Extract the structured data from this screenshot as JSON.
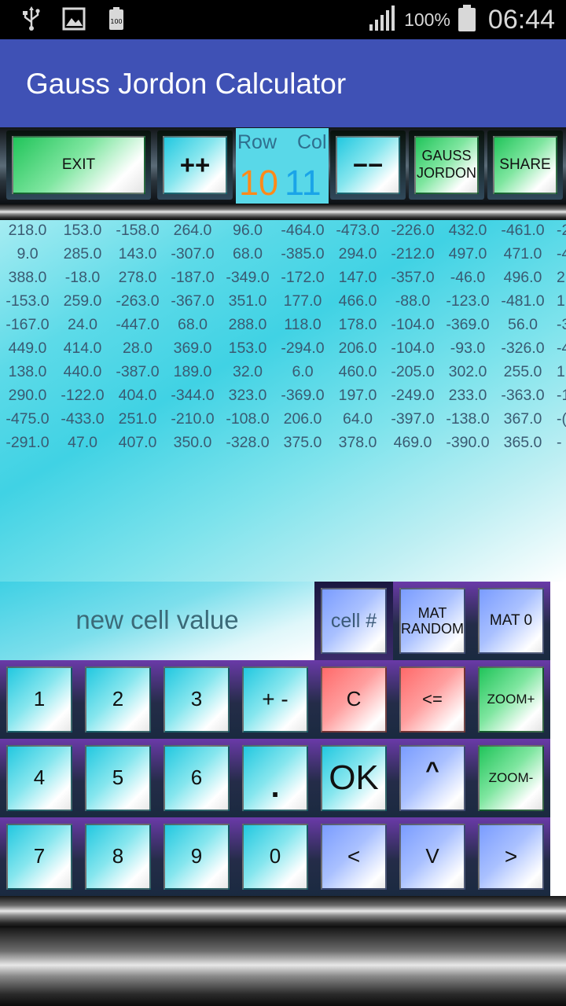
{
  "status_bar": {
    "icons_left": [
      "usb-icon",
      "image-icon",
      "battery-saver-icon"
    ],
    "battery_small_label": "100",
    "signal_icon": "signal-icon",
    "battery_percent": "100%",
    "battery_icon": "battery-icon",
    "time": "06:44"
  },
  "app_bar": {
    "title": "Gauss Jordon Calculator",
    "color": "#3f51b5"
  },
  "toolbar": {
    "exit_label": "EXIT",
    "increment_label": "++",
    "row_label": "Row",
    "col_label": "Col",
    "row_value": "10",
    "col_value": "11",
    "row_value_color": "#ff8a1a",
    "col_value_color": "#1aa4e8",
    "decrement_label": "−−",
    "gauss_line1": "GAUSS",
    "gauss_line2": "JORDON",
    "share_label": "SHARE"
  },
  "matrix": {
    "rows": [
      [
        "218.0",
        "153.0",
        "-158.0",
        "264.0",
        "96.0",
        "-464.0",
        "-473.0",
        "-226.0",
        "432.0",
        "-461.0",
        "-2"
      ],
      [
        "9.0",
        "285.0",
        "143.0",
        "-307.0",
        "68.0",
        "-385.0",
        "294.0",
        "-212.0",
        "497.0",
        "471.0",
        "-4"
      ],
      [
        "388.0",
        "-18.0",
        "278.0",
        "-187.0",
        "-349.0",
        "-172.0",
        "147.0",
        "-357.0",
        "-46.0",
        "496.0",
        "2"
      ],
      [
        "-153.0",
        "259.0",
        "-263.0",
        "-367.0",
        "351.0",
        "177.0",
        "466.0",
        "-88.0",
        "-123.0",
        "-481.0",
        "1"
      ],
      [
        "-167.0",
        "24.0",
        "-447.0",
        "68.0",
        "288.0",
        "118.0",
        "178.0",
        "-104.0",
        "-369.0",
        "56.0",
        "-3"
      ],
      [
        "449.0",
        "414.0",
        "28.0",
        "369.0",
        "153.0",
        "-294.0",
        "206.0",
        "-104.0",
        "-93.0",
        "-326.0",
        "-4"
      ],
      [
        "138.0",
        "440.0",
        "-387.0",
        "189.0",
        "32.0",
        "6.0",
        "460.0",
        "-205.0",
        "302.0",
        "255.0",
        "1"
      ],
      [
        "290.0",
        "-122.0",
        "404.0",
        "-344.0",
        "323.0",
        "-369.0",
        "197.0",
        "-249.0",
        "233.0",
        "-363.0",
        "-1"
      ],
      [
        "-475.0",
        "-433.0",
        "251.0",
        "-210.0",
        "-108.0",
        "206.0",
        "64.0",
        "-397.0",
        "-138.0",
        "367.0",
        "-("
      ],
      [
        "-291.0",
        "47.0",
        "407.0",
        "350.0",
        "-328.0",
        "375.0",
        "378.0",
        "469.0",
        "-390.0",
        "365.0",
        "-"
      ]
    ]
  },
  "keypad": {
    "display_placeholder": "new cell value",
    "cell_label": "cell #",
    "mat_random_line1": "MAT",
    "mat_random_line2": "RANDOM",
    "mat0_label": "MAT 0",
    "keys": {
      "k1": "1",
      "k2": "2",
      "k3": "3",
      "plus_minus": "+ -",
      "clear": "C",
      "backspace": "<=",
      "zoom_in": "ZOOM+",
      "k4": "4",
      "k5": "5",
      "k6": "6",
      "dot": ".",
      "ok": "OK",
      "up": "^",
      "zoom_out": "ZOOM-",
      "k7": "7",
      "k8": "8",
      "k9": "9",
      "k0": "0",
      "left": "<",
      "down": "V",
      "right": ">"
    }
  }
}
